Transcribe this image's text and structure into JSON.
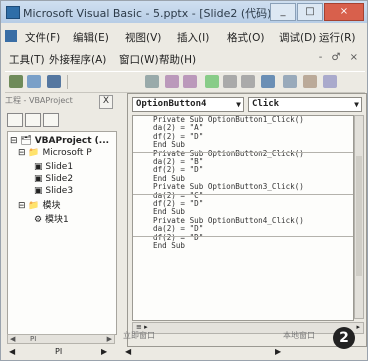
{
  "window": {
    "title": "Microsoft Visual Basic - 5.pptx - [Slide2 (代码)]",
    "controls": [
      "_",
      "□",
      "×"
    ]
  },
  "menu": {
    "items": [
      "文件(F)",
      "编辑(E)",
      "视图(V)",
      "插入(I)",
      "格式(O)",
      "调试(D)",
      "运行(R)"
    ],
    "items2": [
      "工具(T)",
      "外接程序(A)",
      "窗口(W)",
      "帮助(H)"
    ],
    "mdi_controls": "- ♂ ×"
  },
  "project": {
    "title": "工程 - VBAProject",
    "close": "X",
    "tree": [
      {
        "label": "VBAProject (...",
        "level": 0
      },
      {
        "label": "Microsoft P",
        "level": 1
      },
      {
        "label": "Slide1",
        "level": 2
      },
      {
        "label": "Slide2",
        "level": 2
      },
      {
        "label": "Slide3",
        "level": 2
      },
      {
        "label": "模块",
        "level": 1
      },
      {
        "label": "模块1",
        "level": 2
      }
    ],
    "scroll_label": "PI"
  },
  "code": {
    "object_combo": "OptionButton4",
    "proc_combo": "Click",
    "lines": [
      "Private Sub OptionButton1_Click()",
      "da(2) = \"A\"",
      "df(2) = \"D\"",
      "End Sub",
      "",
      "Private Sub OptionButton2_Click()",
      "da(2) = \"B\"",
      "df(2) = \"D\"",
      "End Sub",
      "",
      "Private Sub OptionButton3_Click()",
      "da(2) = \"C\"",
      "df(2) = \"D\"",
      "End Sub",
      "",
      "Private Sub OptionButton4_Click()",
      "da(2) = \"D\"",
      "df(2) = \"D\"",
      "End Sub"
    ]
  },
  "status": {
    "immediate_label": "立即窗口",
    "locals_label": "本地窗口",
    "badge": "2"
  }
}
